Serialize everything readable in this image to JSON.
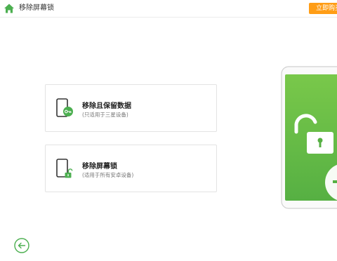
{
  "header": {
    "title": "移除屏幕锁",
    "buy_label": "立即购买",
    "home_icon": "home-icon"
  },
  "options": [
    {
      "title": "移除且保留数据",
      "subtitle": "(只适用于三星设备)",
      "icon": "phone-key-icon"
    },
    {
      "title": "移除屏幕锁",
      "subtitle": "(适用于所有安卓设备)",
      "icon": "phone-unlock-icon"
    }
  ],
  "footer": {
    "back_icon": "back-arrow-icon"
  },
  "colors": {
    "brand_green": "#4caf50",
    "accent_orange": "#ff9d16",
    "illustration_green": "#6abf45"
  }
}
